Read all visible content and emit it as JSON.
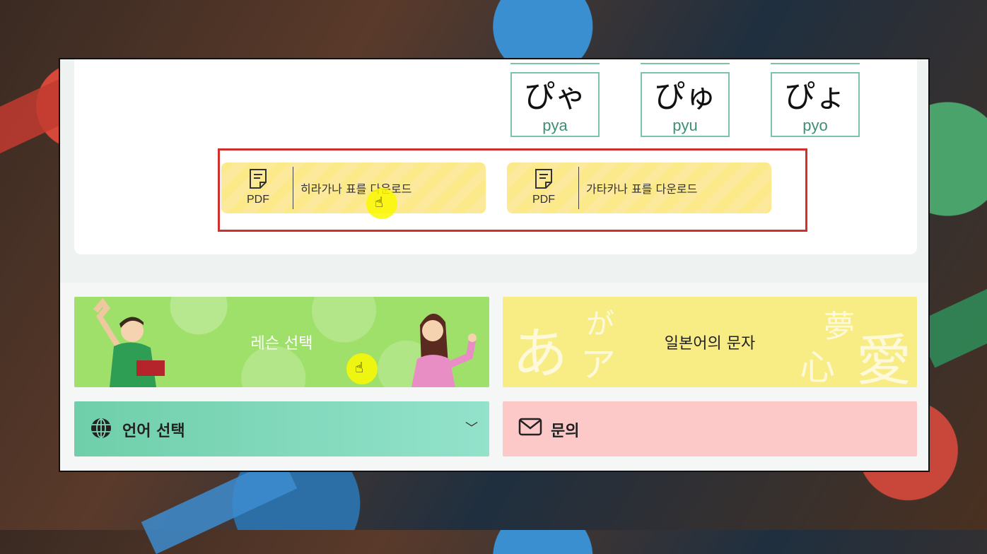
{
  "kana": [
    {
      "char": "ぴゃ",
      "romaji": "pya"
    },
    {
      "char": "ぴゅ",
      "romaji": "pyu"
    },
    {
      "char": "ぴょ",
      "romaji": "pyo"
    }
  ],
  "downloads": [
    {
      "format": "PDF",
      "label": "히라가나 표를 다운로드"
    },
    {
      "format": "PDF",
      "label": "가타카나 표를 다운로드"
    }
  ],
  "tiles": {
    "lesson": "레슨 선택",
    "script": "일본어의 문자",
    "script_deco": [
      "あ",
      "が",
      "ア",
      "夢",
      "心",
      "愛"
    ],
    "language": "언어 선택",
    "contact": "문의"
  },
  "icons": {
    "pdf": "document-icon",
    "globe": "globe-icon",
    "mail": "mail-icon",
    "chevron": "chevron-down-icon",
    "cursor": "hand-pointer-icon"
  },
  "colors": {
    "highlight": "#d0312d",
    "kana_border": "#7cc4a8",
    "download_bg": "#fbe98a",
    "lesson_bg": "#9fe06a",
    "script_bg": "#f8ec84",
    "language_bg": "#6fcfaa",
    "contact_bg": "#fdc8c8"
  }
}
